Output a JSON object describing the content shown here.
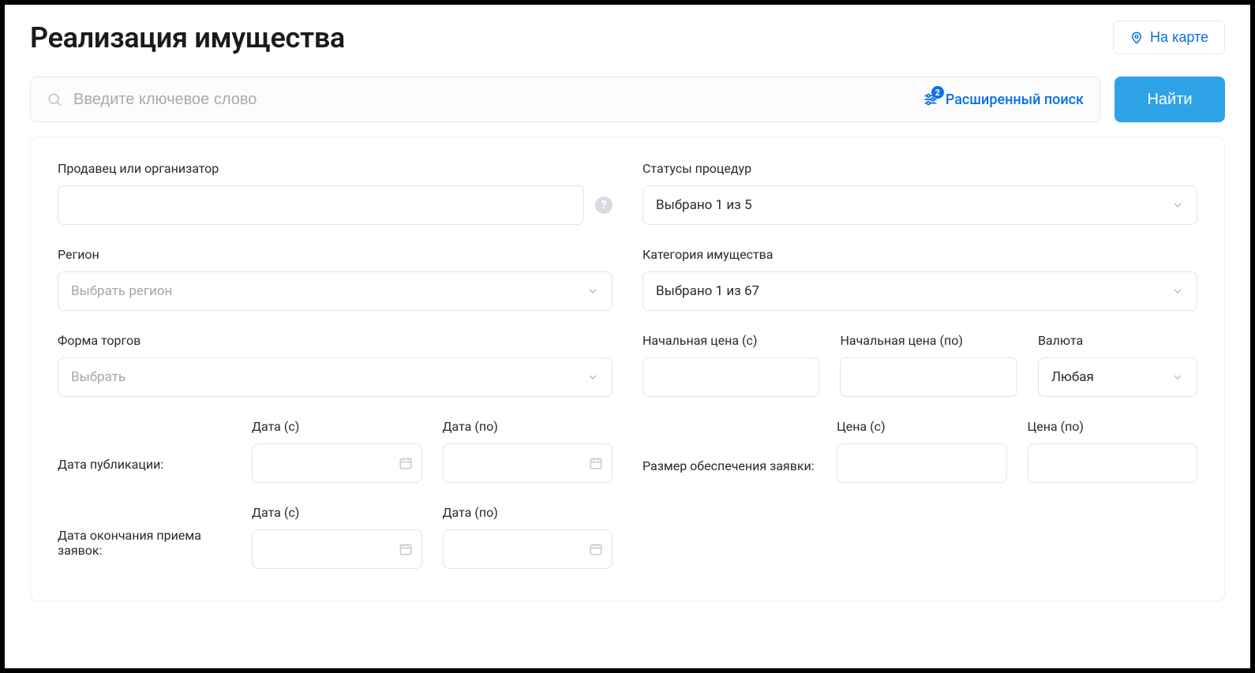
{
  "header": {
    "title": "Реализация имущества",
    "map_button": "На карте"
  },
  "search": {
    "placeholder": "Введите ключевое слово",
    "advanced_label": "Расширенный поиск",
    "advanced_badge": "2",
    "find_button": "Найти"
  },
  "form": {
    "seller": {
      "label": "Продавец или организатор"
    },
    "status": {
      "label": "Статусы процедур",
      "value": "Выбрано 1 из 5"
    },
    "region": {
      "label": "Регион",
      "placeholder": "Выбрать регион"
    },
    "category": {
      "label": "Категория имущества",
      "value": "Выбрано 1 из 67"
    },
    "trade_form": {
      "label": "Форма торгов",
      "placeholder": "Выбрать"
    },
    "price_from": {
      "label": "Начальная цена (с)"
    },
    "price_to": {
      "label": "Начальная цена (по)"
    },
    "currency": {
      "label": "Валюта",
      "value": "Любая"
    },
    "pub_date": {
      "row_label": "Дата публикации:",
      "from_label": "Дата (с)",
      "to_label": "Дата (по)"
    },
    "deposit": {
      "row_label": "Размер обеспечения заявки:",
      "from_label": "Цена (с)",
      "to_label": "Цена (по)"
    },
    "end_date": {
      "row_label": "Дата окончания приема заявок:",
      "from_label": "Дата (с)",
      "to_label": "Дата (по)"
    }
  }
}
